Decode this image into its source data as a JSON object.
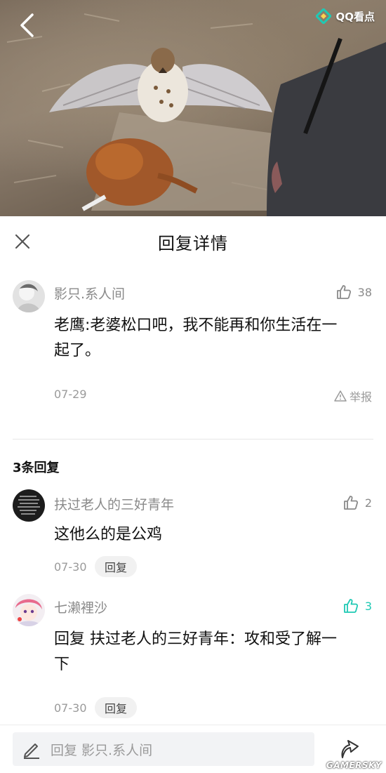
{
  "video": {
    "brand_label": "QQ看点"
  },
  "header": {
    "title": "回复详情"
  },
  "comment": {
    "username": "影只.系人间",
    "likes": "38",
    "text_line1": "老鹰:老婆松口吧，我不能再和你生活在一",
    "text_line2": "起了。",
    "date": "07-29",
    "report_label": "举报"
  },
  "replies_title": "3条回复",
  "replies": [
    {
      "username": "扶过老人的三好青年",
      "likes": "2",
      "text_line1": "这他么的是公鸡",
      "date": "07-30",
      "reply_label": "回复",
      "liked": false
    },
    {
      "username": "七濑裡沙",
      "likes": "3",
      "text_line1": "回复 扶过老人的三好青年：攻和受了解一",
      "text_line2": "下",
      "date": "07-30",
      "reply_label": "回复",
      "liked": true
    }
  ],
  "composer": {
    "placeholder": "回复 影只.系人间"
  },
  "watermark": "GAMERSKY",
  "colors": {
    "accent": "#1fc9b4",
    "muted": "#8a8a8a",
    "text": "#111111"
  },
  "icons": [
    "back-arrow-icon",
    "qq-kandian-logo-icon",
    "close-icon",
    "thumbs-up-icon",
    "warning-icon",
    "pencil-icon",
    "share-icon"
  ]
}
